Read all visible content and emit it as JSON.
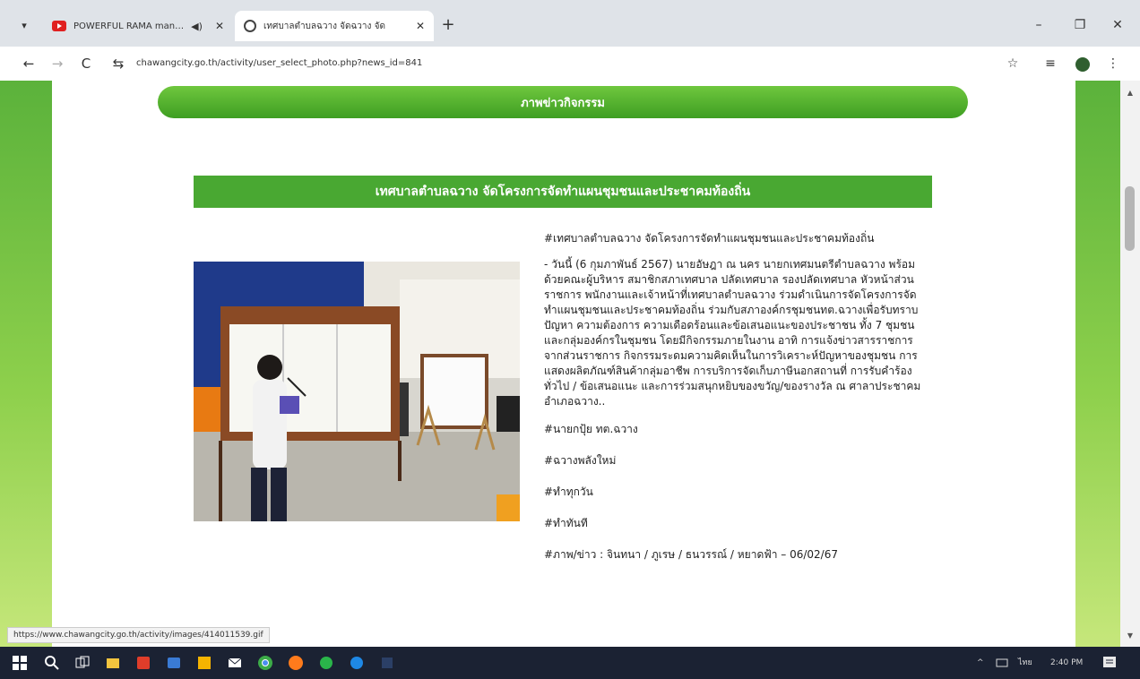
{
  "browser": {
    "menu_glyph": "▾",
    "tabs": [
      {
        "title": "POWERFUL RAMA mante",
        "audio_glyph": "◀)",
        "close_glyph": "✕"
      },
      {
        "title": "เทศบาลตำบลฉวาง จัดฉวาง จัด",
        "close_glyph": "✕"
      }
    ],
    "new_tab_glyph": "+",
    "window": {
      "minimize": "–",
      "restore": "❐",
      "close": "✕"
    },
    "nav": {
      "back": "←",
      "forward": "→",
      "reload": "C",
      "site_info": "⇆"
    },
    "url": "chawangcity.go.th/activity/user_select_photo.php?news_id=841",
    "bookmark_glyph": "☆",
    "extensions_glyph": "≡",
    "menu_more_glyph": "⋮"
  },
  "page": {
    "banner": "ภาพข่าวกิจกรรม",
    "title": "เทศบาลตำบลฉวาง จัดโครงการจัดทำแผนชุมชนและประชาคมท้องถิ่น",
    "headline": "#เทศบาลตำบลฉวาง จัดโครงการจัดทำแผนชุมชนและประชาคมท้องถิ่น",
    "body": "- วันนี้ (6 กุมภาพันธ์ 2567) นายอัษฎา ณ นคร นายกเทศมนตรีตำบลฉวาง พร้อมด้วยคณะผู้บริหาร สมาชิกสภาเทศบาล ปลัดเทศบาล รองปลัดเทศบาล หัวหน้าส่วนราชการ พนักงานและเจ้าหน้าที่เทศบาลตำบลฉวาง ร่วมดำเนินการจัดโครงการจัดทำแผนชุมชนและประชาคมท้องถิ่น ร่วมกับสภาองค์กรชุมชนทต.ฉวางเพื่อรับทราบปัญหา ความต้องการ ความเดือดร้อนและข้อเสนอแนะของประชาชน ทั้ง 7 ชุมชนและกลุ่มองค์กรในชุมชน โดยมีกิจกรรมภายในงาน อาทิ การแจ้งข่าวสารราชการจากส่วนราชการ กิจกรรมระดมความคิดเห็นในการวิเคราะห์ปัญหาของชุมชน การแสดงผลิตภัณฑ์สินค้ากลุ่มอาชีพ การบริการจัดเก็บภาษีนอกสถานที่ การรับคำร้องทั่วไป / ข้อเสนอแนะ และการร่วมสนุกหยิบของขวัญ/ของรางวัล ณ ศาลาประชาคมอำเภอฉวาง..",
    "tags": [
      "#นายกปุ้ย ทต.ฉวาง",
      "#ฉวางพลังใหม่",
      "#ทำทุกวัน",
      "#ทำทันที"
    ],
    "credit": "#ภาพ/ข่าว : จินทนา / ภูเรษ / ธนวรรณ์ / หยาดฟ้า – 06/02/67",
    "status_url": "https://www.chawangcity.go.th/activity/images/414011539.gif"
  },
  "taskbar": {
    "tray_lang": "ไทย",
    "tray_time": "2:40 PM",
    "tray_arrow": "^"
  },
  "colors": {
    "green_banner": "#49a832",
    "green_side": "#8ed04c"
  }
}
